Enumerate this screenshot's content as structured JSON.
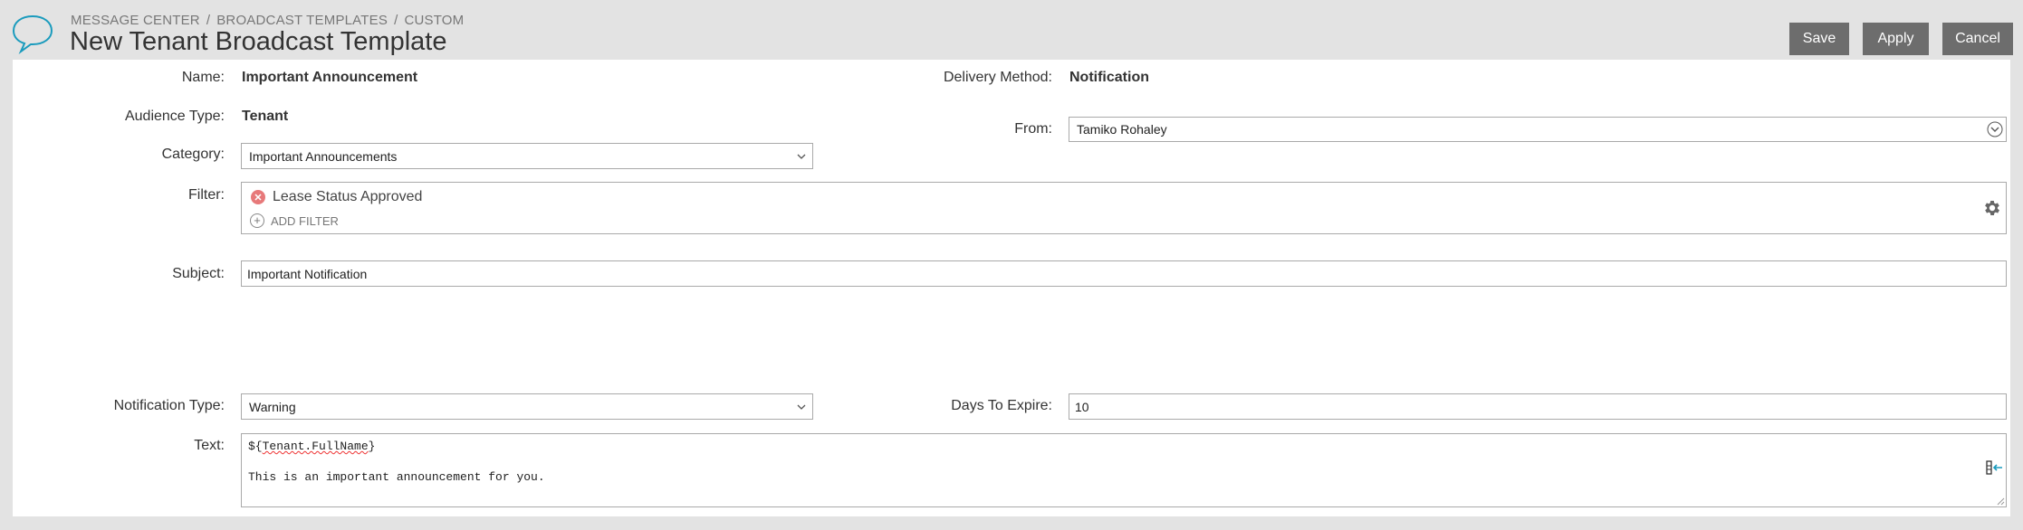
{
  "breadcrumb": [
    "MESSAGE CENTER",
    "BROADCAST TEMPLATES",
    "CUSTOM"
  ],
  "breadcrumb_sep": "/",
  "title": "New Tenant Broadcast Template",
  "buttons": {
    "save": "Save",
    "apply": "Apply",
    "cancel": "Cancel"
  },
  "colors": {
    "accent": "#1a9bbd",
    "button": "#6d6d6d",
    "remove": "#e7797a"
  },
  "form": {
    "name": {
      "label": "Name:",
      "value": "Important Announcement"
    },
    "audience": {
      "label": "Audience Type:",
      "value": "Tenant"
    },
    "category": {
      "label": "Category:",
      "value": "Important Announcements"
    },
    "delivery": {
      "label": "Delivery Method:",
      "value": "Notification"
    },
    "from": {
      "label": "From:",
      "value": "Tamiko Rohaley"
    },
    "filter": {
      "label": "Filter:",
      "items": [
        "Lease Status Approved"
      ],
      "add_label": "ADD FILTER"
    },
    "subject": {
      "label": "Subject:",
      "value": "Important Notification"
    },
    "notification_type": {
      "label": "Notification Type:",
      "value": "Warning"
    },
    "days_to_expire": {
      "label": "Days To Expire:",
      "value": "10"
    },
    "text": {
      "label": "Text:",
      "line1_prefix": "${",
      "line1_var": "Tenant.FullName",
      "line1_suffix": "}",
      "line2": "This is an important announcement for you."
    }
  },
  "icons": {
    "logo": "speech-bubble-icon",
    "remove": "remove-x-icon",
    "add": "plus-circle-icon",
    "settings": "gear-icon",
    "dropdown": "chevron-down-icon",
    "insert": "insert-field-icon"
  }
}
